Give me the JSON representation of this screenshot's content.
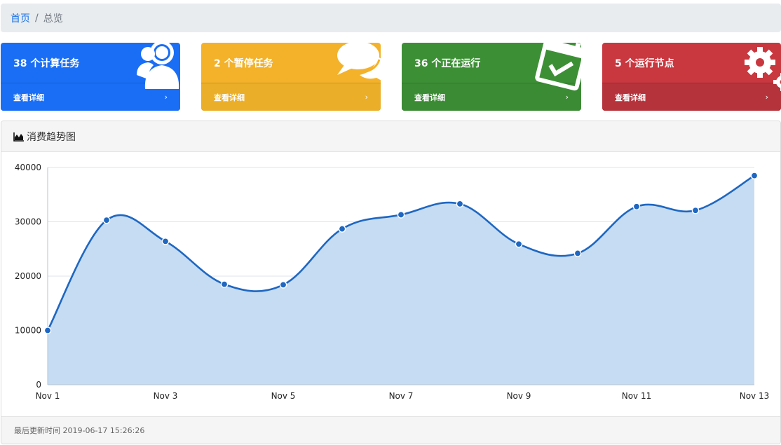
{
  "breadcrumb": {
    "home": "首页",
    "separator": "/",
    "current": "总览"
  },
  "cards": [
    {
      "title": "38 个计算任务",
      "link": "查看详细",
      "chevron": "›",
      "color": "#1a6ef5",
      "icon": "users-icon"
    },
    {
      "title": "2 个暂停任务",
      "link": "查看详细",
      "chevron": "›",
      "color": "#f3b22a",
      "icon": "comments-icon"
    },
    {
      "title": "36 个正在运行",
      "link": "查看详细",
      "chevron": "›",
      "color": "#3d8f36",
      "icon": "calendar-check-icon"
    },
    {
      "title": "5 个运行节点",
      "link": "查看详细",
      "chevron": "›",
      "color": "#c9373f",
      "icon": "gears-icon"
    }
  ],
  "panel": {
    "title": "消费趋势图",
    "title_icon": "area-chart-icon",
    "footer": "最后更新时间 2019-06-17 15:26:26"
  },
  "chart_data": {
    "type": "area",
    "x": [
      "Nov 1",
      "Nov 2",
      "Nov 3",
      "Nov 4",
      "Nov 5",
      "Nov 6",
      "Nov 7",
      "Nov 8",
      "Nov 9",
      "Nov 10",
      "Nov 11",
      "Nov 12",
      "Nov 13"
    ],
    "x_tick_labels": [
      "Nov 1",
      "Nov 3",
      "Nov 5",
      "Nov 7",
      "Nov 9",
      "Nov 11",
      "Nov 13"
    ],
    "values": [
      10000,
      30300,
      26400,
      18500,
      18400,
      28700,
      31300,
      33300,
      25900,
      24200,
      32800,
      32100,
      38500
    ],
    "y_ticks": [
      0,
      10000,
      20000,
      30000,
      40000
    ],
    "ylim": [
      0,
      40000
    ],
    "grid": true,
    "line_color": "#1e67c2",
    "fill_color": "#c6dcf2"
  }
}
